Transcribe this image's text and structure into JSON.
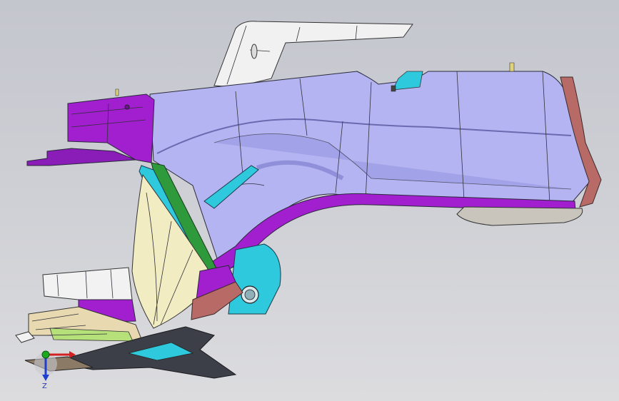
{
  "viewport": {
    "background_top": "#c4c6ce",
    "background_bottom": "#dcdcdf"
  },
  "model": {
    "part_colors": {
      "body": "#b4b4f2",
      "body_shade": "#9d9de6",
      "bracket": "#a21fcf",
      "inner_shell": "#f2ecc2",
      "seal_strip": "#2e9a3c",
      "duct_cyan": "#2ec9dd",
      "flange_rust": "#b86a66",
      "trim_grey": "#c9c4bc",
      "mount_white": "#f2f2f2"
    }
  },
  "triad": {
    "axis_label": "Z",
    "axis_color": "#1f3fd0",
    "x_color": "#d32020",
    "y_color": "#1ea81e"
  }
}
